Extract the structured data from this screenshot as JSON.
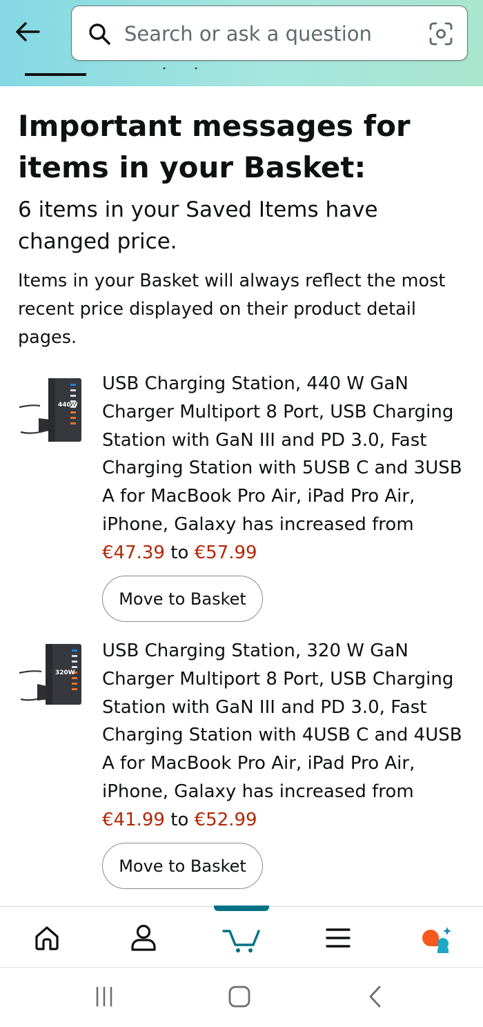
{
  "header": {
    "search_placeholder": "Search or ask a question"
  },
  "messages": {
    "title": "Important messages for items in your Basket:",
    "subtitle": "6 items in your Saved Items have changed price.",
    "note": "Items in your Basket will always reflect the most recent price displayed on their product detail pages."
  },
  "items": [
    {
      "description": "USB Charging Station, 440 W GaN Charger Multiport 8 Port, USB Charging Station with GaN III and PD 3.0, Fast Charging Station with 5USB C and 3USB A for MacBook Pro Air, iPad Pro Air, iPhone, Galaxy has increased from",
      "old_price": "€47.39",
      "connector": "to",
      "new_price": "€57.99",
      "thumb_label": "440W",
      "button_label": "Move to Basket"
    },
    {
      "description": "USB Charging Station, 320 W GaN Charger Multiport 8 Port, USB Charging Station with GaN III and PD 3.0, Fast Charging Station with 4USB C and 4USB A for MacBook Pro Air, iPad Pro Air, iPhone, Galaxy has increased from",
      "old_price": "€41.99",
      "connector": "to",
      "new_price": "€52.99",
      "thumb_label": "320W",
      "button_label": "Move to Basket"
    }
  ],
  "bottom_nav": {
    "items": [
      {
        "icon": "home-icon"
      },
      {
        "icon": "account-icon"
      },
      {
        "icon": "cart-icon",
        "active": true
      },
      {
        "icon": "menu-icon"
      },
      {
        "icon": "rufus-assistant-icon"
      }
    ]
  },
  "colors": {
    "price": "#b12704",
    "active_tab": "#007185",
    "header_gradient_start": "#84d8e4",
    "header_gradient_end": "#a9e6cf",
    "assistant_orange": "#f7581f",
    "assistant_teal": "#1fa6c4"
  }
}
